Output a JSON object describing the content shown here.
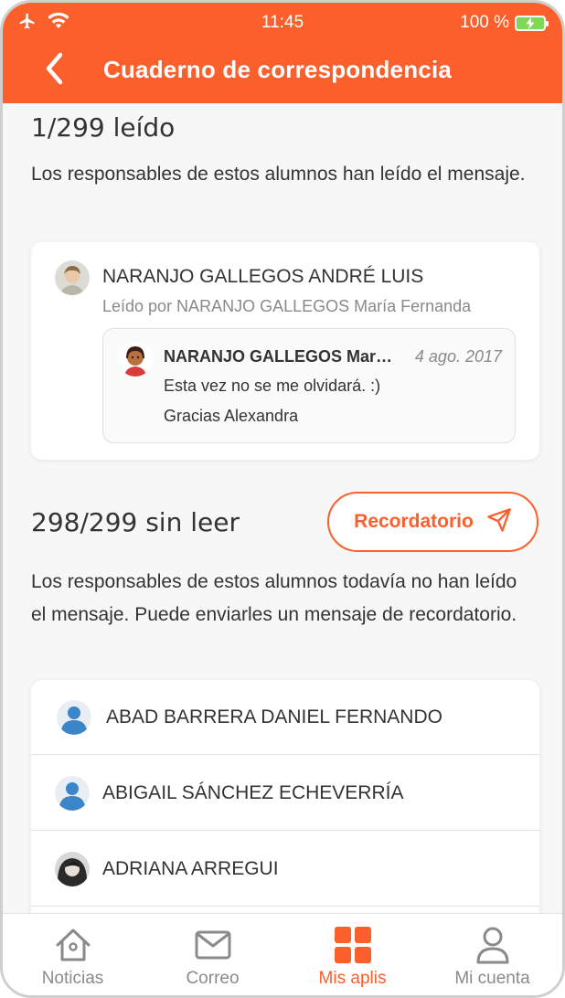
{
  "status_bar": {
    "time": "11:45",
    "battery": "100 %"
  },
  "header": {
    "title": "Cuaderno de correspondencia"
  },
  "read_section": {
    "heading": "1/299 leído",
    "description": "Los responsables de estos alumnos han leído el mensaje.",
    "student_name": "NARANJO GALLEGOS ANDRÉ LUIS",
    "read_by": "Leído por NARANJO GALLEGOS María Fernanda",
    "reply": {
      "author": "NARANJO GALLEGOS María Fernanda",
      "date": "4 ago. 2017",
      "line1": "Esta vez no se me olvidará. :)",
      "line2": "Gracias Alexandra"
    }
  },
  "unread_section": {
    "heading": "298/299 sin leer",
    "reminder_label": "Recordatorio",
    "description": "Los responsables de estos alumnos todavía no han leído el mensaje. Puede enviarles un mensaje de recordatorio.",
    "students": [
      {
        "name": "ABAD BARRERA DANIEL FERNANDO",
        "avatar": "user-default-icon"
      },
      {
        "name": "ABIGAIL SÁNCHEZ ECHEVERRÍA",
        "avatar": "user-default-icon"
      },
      {
        "name": "ADRIANA ARREGUI",
        "avatar": "photo"
      }
    ]
  },
  "tabbar": {
    "tabs": [
      {
        "label": "Noticias",
        "icon": "home-icon"
      },
      {
        "label": "Correo",
        "icon": "mail-icon"
      },
      {
        "label": "Mis aplis",
        "icon": "apps-grid-icon",
        "active": true
      },
      {
        "label": "Mi cuenta",
        "icon": "account-icon"
      }
    ]
  },
  "colors": {
    "accent": "#fb5f2c",
    "text": "#333333",
    "muted": "#8a8a8a",
    "background": "#f7f7f7"
  }
}
